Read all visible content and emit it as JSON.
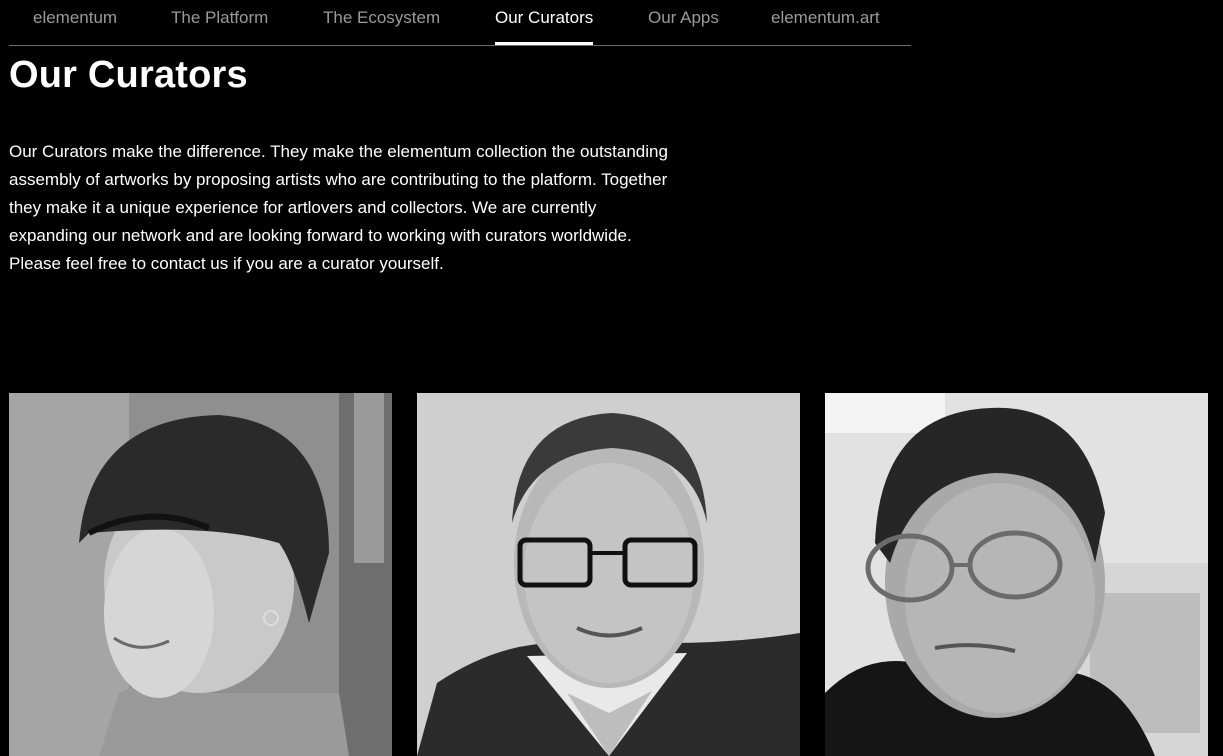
{
  "nav": {
    "items": [
      {
        "label": "elementum"
      },
      {
        "label": "The Platform"
      },
      {
        "label": "The Ecosystem"
      },
      {
        "label": "Our Curators"
      },
      {
        "label": "Our Apps"
      },
      {
        "label": "elementum.art"
      }
    ],
    "active": "Our Curators"
  },
  "page": {
    "title": "Our Curators",
    "intro": "Our Curators make the difference. They make the elementum collection the outstanding assembly of artworks by proposing artists who are contributing to the platform. Together they make it a unique experience for artlovers and collectors. We are currently expanding our network and are looking forward to working with curators worldwide. Please feel free to contact us if you are a curator yourself."
  },
  "curators": [
    {
      "photo": "woman-bowl-haircut-portrait"
    },
    {
      "photo": "man-glasses-suit-portrait"
    },
    {
      "photo": "man-glasses-selfie-portrait"
    }
  ]
}
